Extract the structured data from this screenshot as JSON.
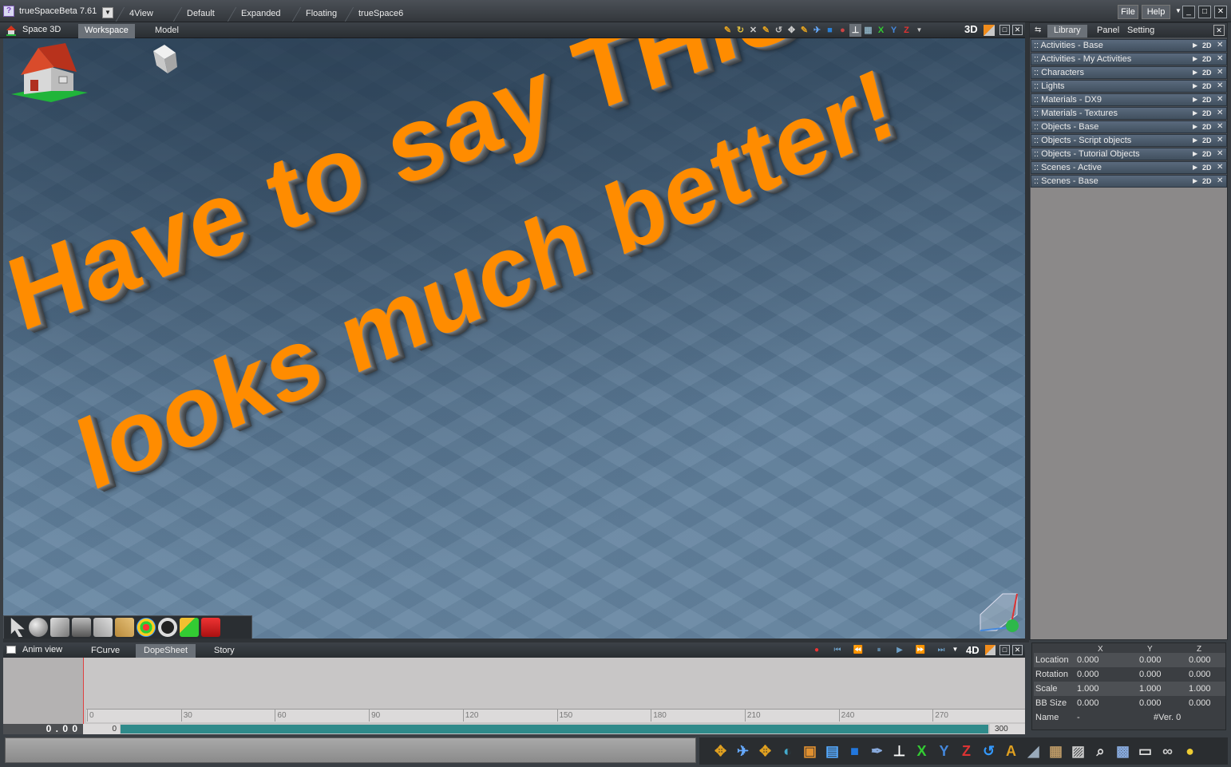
{
  "titlebar": {
    "app_title": "trueSpaceBeta 7.61",
    "layout_tabs": [
      "4View",
      "Default",
      "Expanded",
      "Floating",
      "trueSpace6"
    ],
    "menu_file": "File",
    "menu_help": "Help"
  },
  "viewport": {
    "space_label": "Space 3D",
    "tabs": [
      "Workspace",
      "Model"
    ],
    "mode": "3D",
    "axis_x": "X",
    "axis_y": "Y",
    "axis_z": "Z",
    "scene_text_line1": "Have to say THIS",
    "scene_text_line2": "looks much better!"
  },
  "library": {
    "tabs": [
      "Library",
      "Panel",
      "Setting"
    ],
    "items": [
      ":: Activities - Base",
      ":: Activities - My Activities",
      ":: Characters",
      ":: Lights",
      ":: Materials - DX9",
      ":: Materials - Textures",
      ":: Objects - Base",
      ":: Objects - Script objects",
      ":: Objects - Tutorial Objects",
      ":: Scenes - Active",
      ":: Scenes - Base"
    ],
    "item_mode": "2D"
  },
  "anim": {
    "label": "Anim view",
    "tabs": [
      "FCurve",
      "DopeSheet",
      "Story"
    ],
    "mode": "4D",
    "ruler_ticks": [
      "0",
      "30",
      "60",
      "90",
      "120",
      "150",
      "180",
      "210",
      "240",
      "270"
    ],
    "time_readout": "0 . 0 0",
    "range_start": "0",
    "range_end": "300"
  },
  "properties": {
    "columns": [
      "X",
      "Y",
      "Z"
    ],
    "rows": [
      {
        "label": "Location",
        "x": "0.000",
        "y": "0.000",
        "z": "0.000"
      },
      {
        "label": "Rotation",
        "x": "0.000",
        "y": "0.000",
        "z": "0.000"
      },
      {
        "label": "Scale",
        "x": "1.000",
        "y": "1.000",
        "z": "1.000"
      },
      {
        "label": "BB Size",
        "x": "0.000",
        "y": "0.000",
        "z": "0.000"
      }
    ],
    "name_label": "Name",
    "name_value": "-",
    "version": "#Ver. 0"
  },
  "colors": {
    "accent_orange": "#ff8c00",
    "library_item": "#4f5f71",
    "timeline_range": "#2f8a8a"
  }
}
